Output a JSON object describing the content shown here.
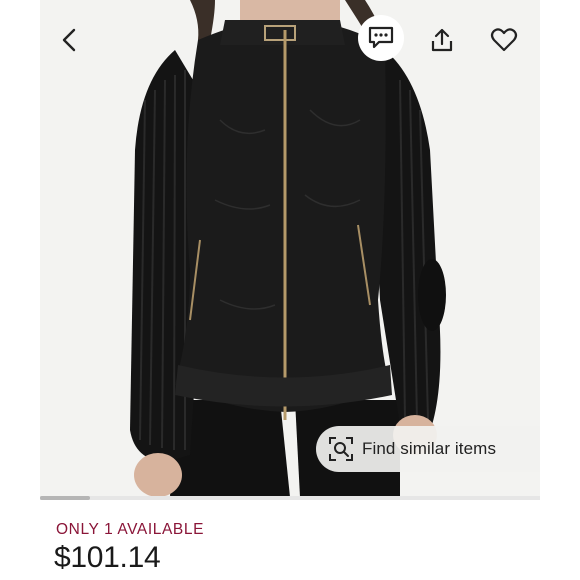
{
  "header": {
    "back_icon": "chevron-left-icon",
    "message_icon": "message-icon",
    "share_icon": "share-icon",
    "favorite_icon": "heart-icon"
  },
  "image": {
    "description_icon": "jacket-photo",
    "carousel_progress": 0.1
  },
  "find_similar": {
    "label": "Find similar items",
    "icon": "visual-search-icon"
  },
  "listing": {
    "availability": "ONLY 1 AVAILABLE",
    "price": "$101.14"
  },
  "colors": {
    "availability": "#8a1538",
    "price": "#1a1a1a"
  }
}
